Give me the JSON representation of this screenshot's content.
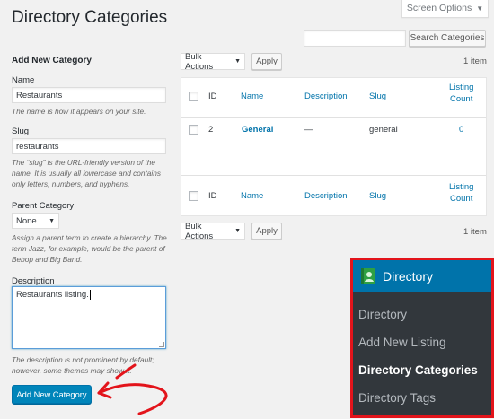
{
  "page": {
    "title": "Directory Categories",
    "screen_options": "Screen Options",
    "search_button": "Search Categories",
    "search_value": ""
  },
  "form": {
    "title": "Add New Category",
    "name_label": "Name",
    "name_value": "Restaurants",
    "name_hint": "The name is how it appears on your site.",
    "slug_label": "Slug",
    "slug_value": "restaurants",
    "slug_hint_1": "The “slug” is the URL-friendly version of the",
    "slug_hint_2": "name. It is usually all lowercase and contains",
    "slug_hint_3": "only letters, numbers, and hyphens.",
    "parent_label": "Parent Category",
    "parent_value": "None",
    "parent_hint_1": "Assign a parent term to create a hierarchy. The",
    "parent_hint_2": "term Jazz, for example, would be the parent of",
    "parent_hint_3": "Bebop and Big Band.",
    "desc_label": "Description",
    "desc_value": "Restaurants listing.",
    "desc_hint_1": "The description is not prominent by default;",
    "desc_hint_2": "however, some themes may show it.",
    "submit": "Add New Category"
  },
  "table": {
    "bulk_actions": "Bulk Actions",
    "apply": "Apply",
    "item_count": "1 item",
    "headers": {
      "id": "ID",
      "name": "Name",
      "description": "Description",
      "slug": "Slug",
      "count_1": "Listing",
      "count_2": "Count"
    },
    "rows": [
      {
        "id": "2",
        "name": "General",
        "description": "—",
        "slug": "general",
        "count": "0"
      }
    ]
  },
  "menu": {
    "title": "Directory",
    "items": [
      {
        "label": "Directory"
      },
      {
        "label": "Add New Listing"
      },
      {
        "label": "Directory Categories"
      },
      {
        "label": "Directory Tags"
      }
    ]
  },
  "colors": {
    "accent": "#0073aa",
    "primary_button": "#0085ba",
    "highlight_border": "#e3141b",
    "menu_bg": "#32373c"
  }
}
